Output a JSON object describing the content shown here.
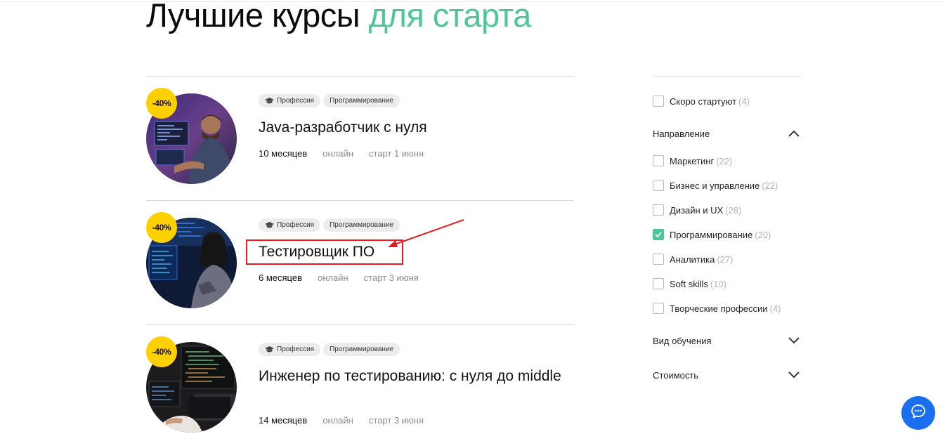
{
  "header": {
    "title_main": "Лучшие курсы",
    "title_accent": "для старта"
  },
  "courses": [
    {
      "discount": "-40%",
      "tags": [
        "Профессия",
        "Программирование"
      ],
      "title": "Java-разработчик с нуля",
      "duration": "10 месяцев",
      "format": "онлайн",
      "start": "старт 1 июня"
    },
    {
      "discount": "-40%",
      "tags": [
        "Профессия",
        "Программирование"
      ],
      "title": "Тестировщик ПО",
      "duration": "6 месяцев",
      "format": "онлайн",
      "start": "старт 3 июня"
    },
    {
      "discount": "-40%",
      "tags": [
        "Профессия",
        "Программирование"
      ],
      "title": "Инженер по тестированию: с нуля до middle",
      "duration": "14 месяцев",
      "format": "онлайн",
      "start": "старт 3 июня"
    }
  ],
  "sidebar": {
    "soon": {
      "label": "Скоро стартуют",
      "count": "(4)",
      "checked": false
    },
    "direction": {
      "title": "Направление",
      "expanded": true,
      "items": [
        {
          "label": "Маркетинг",
          "count": "(22)",
          "checked": false
        },
        {
          "label": "Бизнес и управление",
          "count": "(22)",
          "checked": false
        },
        {
          "label": "Дизайн и UX",
          "count": "(28)",
          "checked": false
        },
        {
          "label": "Программирование",
          "count": "(20)",
          "checked": true
        },
        {
          "label": "Аналитика",
          "count": "(27)",
          "checked": false
        },
        {
          "label": "Soft skills",
          "count": "(10)",
          "checked": false
        },
        {
          "label": "Творческие профессии",
          "count": "(4)",
          "checked": false
        }
      ]
    },
    "study_type": {
      "title": "Вид обучения",
      "expanded": false
    },
    "price": {
      "title": "Стоимость",
      "expanded": false
    }
  },
  "colors": {
    "accent": "#4cc79a",
    "badge": "#ffd000",
    "annotation": "#e02020",
    "chat": "#1a6ff0"
  },
  "icons": {
    "tag_profession": "graduation-cap-icon",
    "chat": "chat-bubble-icon",
    "expand": "chevron-down-icon",
    "collapse": "chevron-up-icon"
  }
}
